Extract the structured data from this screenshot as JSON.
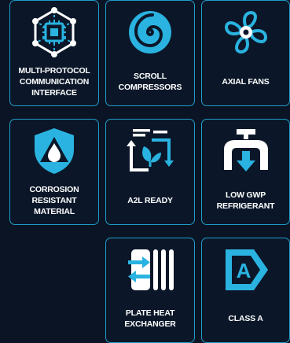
{
  "colors": {
    "background": "#0a1424",
    "tile_background": "#0b1729",
    "tile_border": "#1f9ec9",
    "icon_fill": "#ffffff",
    "icon_accent": "#2ab3e0",
    "label_text": "#ffffff"
  },
  "features": [
    {
      "id": "multi-protocol",
      "icon": "network-chip-icon",
      "label": "MULTI-PROTOCOL\nCOMMUNICATION\nINTERFACE"
    },
    {
      "id": "scroll-compressors",
      "icon": "spiral-icon",
      "label": "SCROLL\nCOMPRESSORS"
    },
    {
      "id": "axial-fans",
      "icon": "fan-icon",
      "label": "AXIAL FANS"
    },
    {
      "id": "corrosion-resistant",
      "icon": "shield-droplet-icon",
      "label": "CORROSION\nRESISTANT MATERIAL"
    },
    {
      "id": "a2l-ready",
      "icon": "recycle-leaf-icon",
      "label": "A2L READY"
    },
    {
      "id": "low-gwp",
      "icon": "pipe-arrow-icon",
      "label": "LOW GWP\nREFRIGERANT"
    },
    {
      "id": "plate-heat-exchanger",
      "icon": "plate-exchanger-icon",
      "label": "PLATE HEAT\nEXCHANGER"
    },
    {
      "id": "class-a",
      "icon": "energy-class-a-icon",
      "label": "CLASS A",
      "badge_letter": "A"
    }
  ]
}
